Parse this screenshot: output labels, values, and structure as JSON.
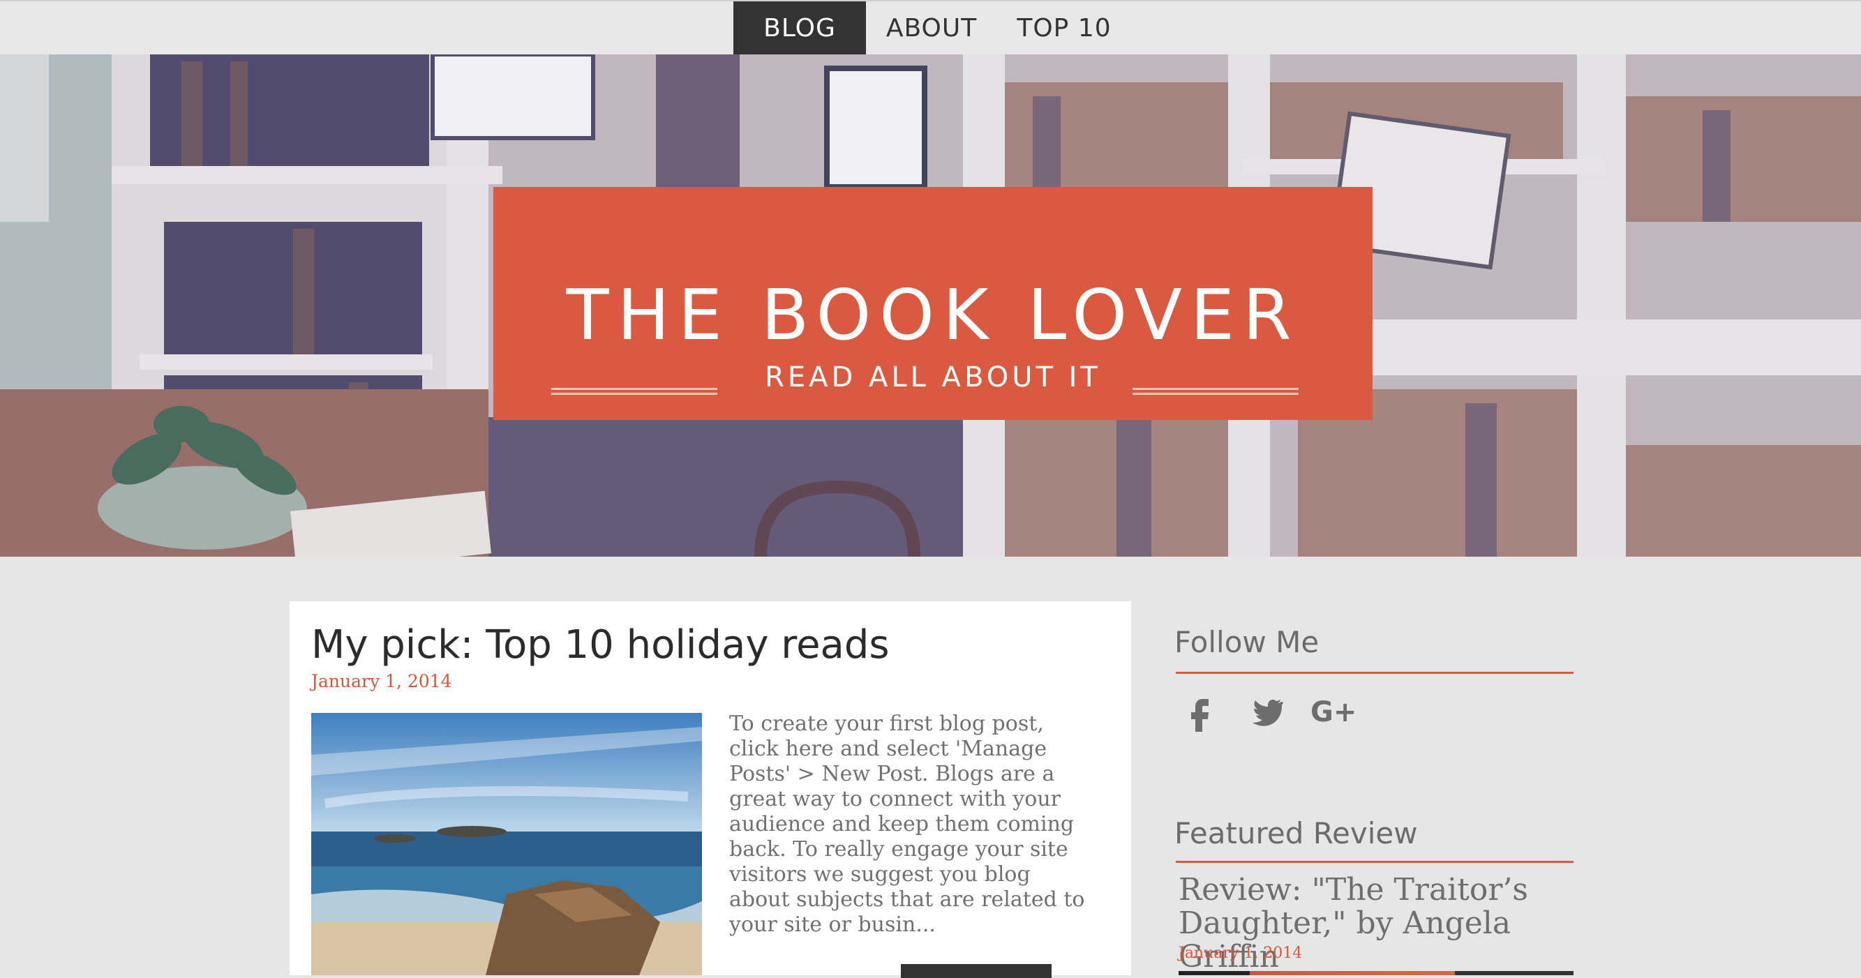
{
  "nav": {
    "items": [
      {
        "label": "BLOG",
        "active": true
      },
      {
        "label": "ABOUT",
        "active": false
      },
      {
        "label": "TOP 10",
        "active": false
      }
    ]
  },
  "hero": {
    "title": "THE BOOK LOVER",
    "tagline": "READ ALL ABOUT IT"
  },
  "post": {
    "title": "My pick: Top 10 holiday reads",
    "date": "January 1, 2014",
    "excerpt": "To create your first blog post, click here and select 'Manage Posts' > New Post. Blogs are a great way to connect with your audience and keep them coming back. To really engage your site visitors we suggest you blog about subjects that are related to your site or busin..."
  },
  "sidebar": {
    "follow_heading": "Follow Me",
    "social_icons": [
      "facebook-icon",
      "twitter-icon",
      "google-plus-icon"
    ],
    "featured_heading": "Featured Review",
    "review_title": "Review: \"The Traitor’s Daughter,\" by Angela Griffin",
    "review_date": "January 1, 2014"
  },
  "colors": {
    "accent": "#d95a40",
    "nav_active": "#333333",
    "background": "#e6e6e6"
  }
}
